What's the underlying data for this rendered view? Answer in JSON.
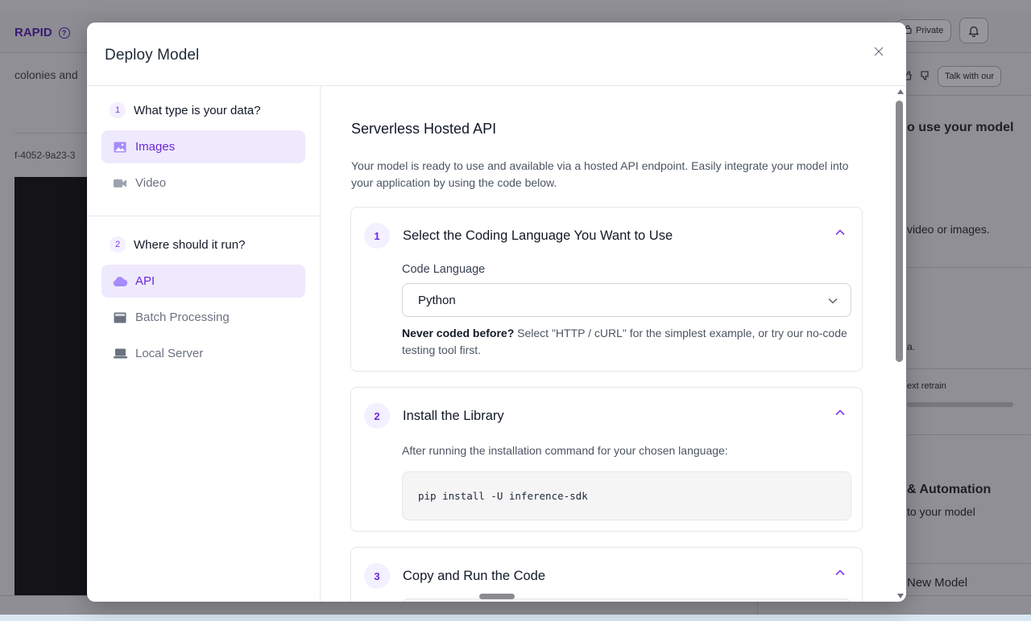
{
  "background": {
    "brand": "RAPID",
    "subtitle": "colonies and",
    "uuid": "f-4052-9a23-3",
    "private_label": "Private",
    "talk_label": "Talk with our",
    "right_texts": {
      "use_model": "o use your model",
      "video_images": "video or images.",
      "a_dot": "a.",
      "retrain": "ext retrain",
      "automation": "& Automation",
      "to_model": "to your model",
      "new_model": "New Model"
    }
  },
  "modal": {
    "title": "Deploy Model",
    "close_icon": "close-icon"
  },
  "steps": {
    "group1": {
      "num": "1",
      "label": "What type is your data?",
      "options": [
        {
          "label": "Images",
          "icon": "image-icon",
          "active": true
        },
        {
          "label": "Video",
          "icon": "video-icon",
          "active": false
        }
      ]
    },
    "group2": {
      "num": "2",
      "label": "Where should it run?",
      "options": [
        {
          "label": "API",
          "icon": "cloud-icon",
          "active": true
        },
        {
          "label": "Batch Processing",
          "icon": "batch-icon",
          "active": false
        },
        {
          "label": "Local Server",
          "icon": "laptop-icon",
          "active": false
        }
      ]
    }
  },
  "content": {
    "title": "Serverless Hosted API",
    "description": "Your model is ready to use and available via a hosted API endpoint. Easily integrate your model into your application by using the code below.",
    "cards": [
      {
        "num": "1",
        "title": "Select the Coding Language You Want to Use",
        "field_label": "Code Language",
        "select_value": "Python",
        "hint_bold": "Never coded before?",
        "hint_rest": " Select \"HTTP / cURL\" for the simplest example, or try our no-code testing tool first."
      },
      {
        "num": "2",
        "title": "Install the Library",
        "text": "After running the installation command for your chosen language:",
        "code": "pip install -U inference-sdk"
      },
      {
        "num": "3",
        "title": "Copy and Run the Code"
      }
    ]
  },
  "colors": {
    "accent": "#7c3aed",
    "active_bg": "#efe9fd",
    "overlay": "#8f8f95"
  }
}
